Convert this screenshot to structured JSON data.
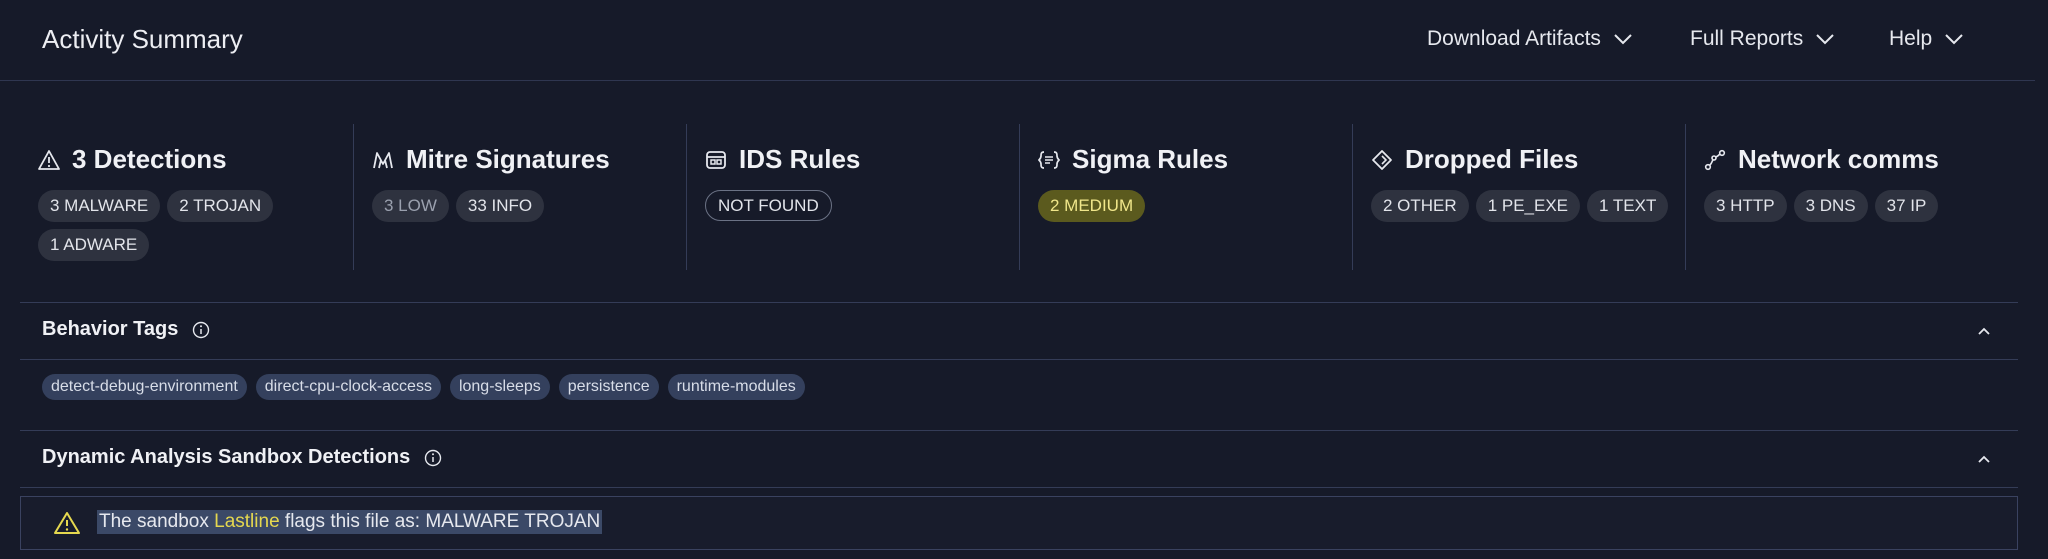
{
  "header": {
    "title": "Activity Summary",
    "menus": [
      "Download Artifacts",
      "Full Reports",
      "Help"
    ]
  },
  "cards": [
    {
      "icon": "warning-triangle-icon",
      "title": "3 Detections",
      "pills": [
        "3 MALWARE",
        "2 TROJAN",
        "1 ADWARE"
      ]
    },
    {
      "icon": "mitre-logo-icon",
      "title": "Mitre Signatures",
      "pills": [
        "3 LOW",
        "33 INFO"
      ]
    },
    {
      "icon": "ids-rules-icon",
      "title": "IDS Rules",
      "pills": [
        "NOT FOUND"
      ]
    },
    {
      "icon": "sigma-rules-icon",
      "title": "Sigma Rules",
      "pills": [
        "2 MEDIUM"
      ]
    },
    {
      "icon": "dropped-files-icon",
      "title": "Dropped Files",
      "pills": [
        "2 OTHER",
        "1 PE_EXE",
        "1 TEXT"
      ]
    },
    {
      "icon": "network-icon",
      "title": "Network comms",
      "pills": [
        "3 HTTP",
        "3 DNS",
        "37 IP"
      ]
    }
  ],
  "behavior": {
    "title": "Behavior Tags",
    "tags": [
      "detect-debug-environment",
      "direct-cpu-clock-access",
      "long-sleeps",
      "persistence",
      "runtime-modules"
    ]
  },
  "sandbox": {
    "title": "Dynamic Analysis Sandbox Detections",
    "row": {
      "prefix": "The sandbox ",
      "link": "Lastline",
      "suffix": " flags this file as: MALWARE TROJAN"
    }
  },
  "colors": {
    "background": "#161a29",
    "accent_yellow": "#e5d84f",
    "medium_badge": "#5b5a1e",
    "tag_bg": "#34405d"
  }
}
